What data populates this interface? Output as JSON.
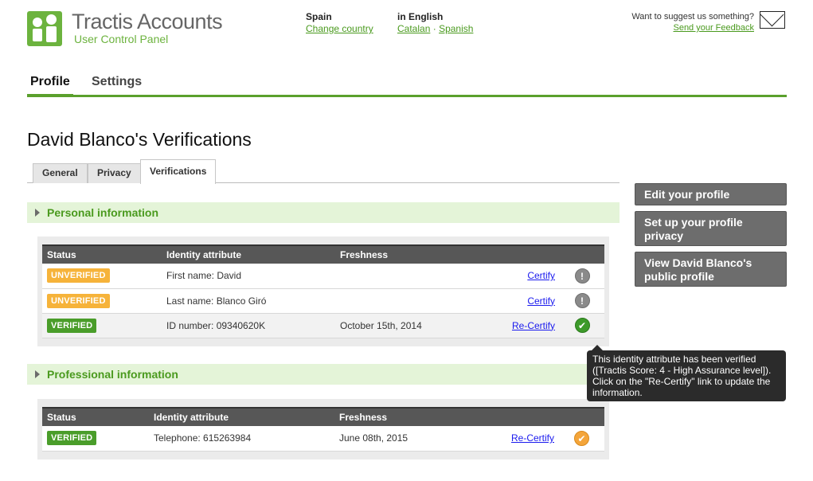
{
  "header": {
    "brand_title": "Tractis Accounts",
    "brand_subtitle": "User Control Panel",
    "country": {
      "label": "Spain",
      "link": "Change country"
    },
    "language": {
      "label": "in English",
      "link1": "Catalan",
      "separator": "·",
      "link2": "Spanish"
    },
    "feedback": {
      "question": "Want to suggest us something?",
      "link": "Send your Feedback"
    }
  },
  "main_tabs": {
    "profile": "Profile",
    "settings": "Settings"
  },
  "page_title": "David Blanco's Verifications",
  "sub_tabs": {
    "general": "General",
    "privacy": "Privacy",
    "verifications": "Verifications"
  },
  "personal": {
    "title": "Personal information",
    "columns": {
      "status": "Status",
      "attribute": "Identity attribute",
      "freshness": "Freshness"
    },
    "rows": [
      {
        "status": "UNVERIFIED",
        "attribute": "First name: David",
        "freshness": "",
        "action": "Certify",
        "icon": "!"
      },
      {
        "status": "UNVERIFIED",
        "attribute": "Last name: Blanco Giró",
        "freshness": "",
        "action": "Certify",
        "icon": "!"
      },
      {
        "status": "VERIFIED",
        "attribute": "ID number: 09340620K",
        "freshness": "October 15th, 2014",
        "action": "Re-Certify",
        "icon": "✔"
      }
    ]
  },
  "professional": {
    "title": "Professional information",
    "columns": {
      "status": "Status",
      "attribute": "Identity attribute",
      "freshness": "Freshness"
    },
    "rows": [
      {
        "status": "VERIFIED",
        "attribute": "Telephone: 615263984",
        "freshness": "June 08th, 2015",
        "action": "Re-Certify",
        "icon": "✔"
      }
    ]
  },
  "sidebar": {
    "edit": "Edit your profile",
    "privacy": "Set up your profile privacy",
    "public": "View David Blanco's public profile"
  },
  "tooltip": "This identity attribute has been verified ([Tractis Score: 4 - High Assurance level]). Click on the \"Re-Certify\" link to update the information.",
  "colors": {
    "accent": "#5aa02c",
    "verified": "#4a9d2a",
    "unverified": "#f6b33a"
  }
}
